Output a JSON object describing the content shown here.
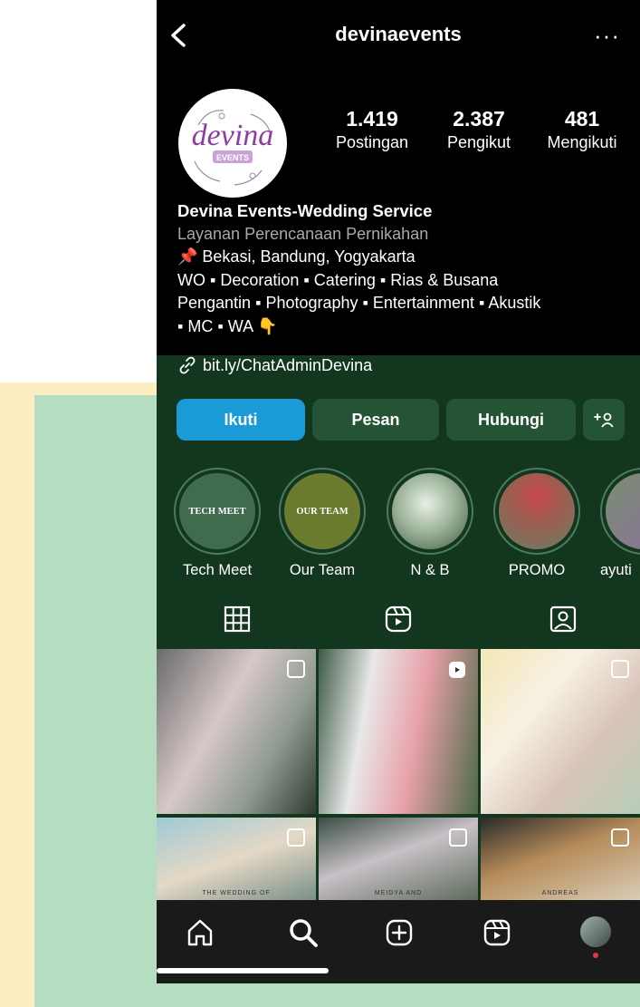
{
  "profile": {
    "username": "devinaevents",
    "avatar_text": "devina",
    "avatar_subtext": "EVENTS"
  },
  "stats": [
    {
      "value": "1.419",
      "label": "Postingan"
    },
    {
      "value": "2.387",
      "label": "Pengikut"
    },
    {
      "value": "481",
      "label": "Mengikuti"
    }
  ],
  "bio": {
    "name": "Devina Events-Wedding Service",
    "category": "Layanan Perencanaan Pernikahan",
    "line1": "📌 Bekasi, Bandung, Yogyakarta",
    "line2": "WO ▪ Decoration ▪ Catering ▪ Rias & Busana",
    "line3": "Pengantin ▪ Photography ▪ Entertainment ▪ Akustik",
    "line4": "▪ MC ▪ WA 👇",
    "link": "bit.ly/ChatAdminDevina"
  },
  "buttons": {
    "follow": "Ikuti",
    "message": "Pesan",
    "contact": "Hubungi",
    "add_user": "+ጸ"
  },
  "highlights": [
    {
      "label": "Tech Meet",
      "cover_text": "TECH MEET"
    },
    {
      "label": "Our Team",
      "cover_text": "OUR TEAM"
    },
    {
      "label": "N & B",
      "cover_text": ""
    },
    {
      "label": "PROMO",
      "cover_text": ""
    },
    {
      "label": "ayuti",
      "cover_text": ""
    }
  ],
  "grid_captions": [
    "THE WEDDING OF",
    "MEIDYA AND",
    "ANDREAS"
  ],
  "colors": {
    "follow_button": "#1a9bd8",
    "secondary_button": "#245335",
    "background": "#000000"
  }
}
